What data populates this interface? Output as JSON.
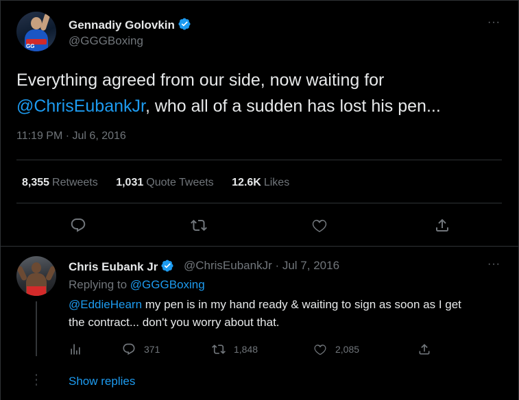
{
  "main_tweet": {
    "author_name": "Gennadiy Golovkin",
    "author_handle": "@GGGBoxing",
    "avatar_label": "GG",
    "text_part1": "Everything agreed from our side, now  waiting for",
    "mention": "@ChrisEubankJr",
    "text_part2": ", who all of a sudden has lost his pen...",
    "timestamp": "11:19 PM · Jul 6, 2016",
    "stats": [
      {
        "value": "8,355",
        "label": "Retweets"
      },
      {
        "value": "1,031",
        "label": "Quote Tweets"
      },
      {
        "value": "12.6K",
        "label": "Likes"
      }
    ],
    "more": "···"
  },
  "reply_tweet": {
    "author_name": "Chris Eubank Jr",
    "meta": "@ChrisEubankJr · Jul 7, 2016",
    "replying_prefix": "Replying to",
    "replying_handle": "@GGGBoxing",
    "mention": "@EddieHearn",
    "text_line1": " my pen is in my hand ready & waiting to sign as soon as I get",
    "text_line2": "the contract... don't you worry about that.",
    "replies": "371",
    "retweets": "1,848",
    "likes": "2,085",
    "more": "···"
  },
  "show_replies": "Show replies",
  "colors": {
    "accent": "#1d9bf0",
    "muted": "#71767b",
    "text": "#e7e9ea",
    "background": "#000000"
  }
}
